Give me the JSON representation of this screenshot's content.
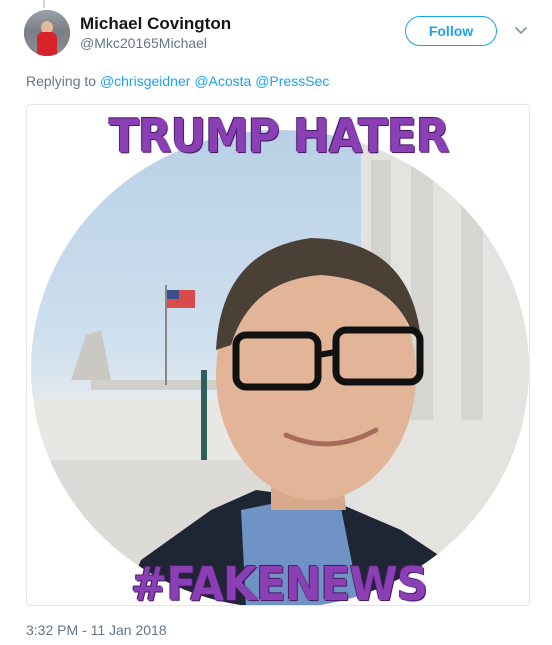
{
  "tweet": {
    "author_name": "Michael Covington",
    "author_handle": "@Mkc20165Michael",
    "follow_label": "Follow",
    "replying_to_prefix": "Replying to",
    "replying_to": [
      "@chrisgeidner",
      "@Acosta",
      "@PressSec"
    ],
    "timestamp": "3:32 PM - 11 Jan 2018"
  },
  "media": {
    "top_caption": "TRUMP HATER",
    "bottom_caption": "#FAKENEWS",
    "caption_color": "#8a3fb5"
  },
  "icons": {
    "chevron": "chevron-down-icon"
  },
  "colors": {
    "accent": "#1da1f2",
    "secondary_text": "#657786"
  }
}
